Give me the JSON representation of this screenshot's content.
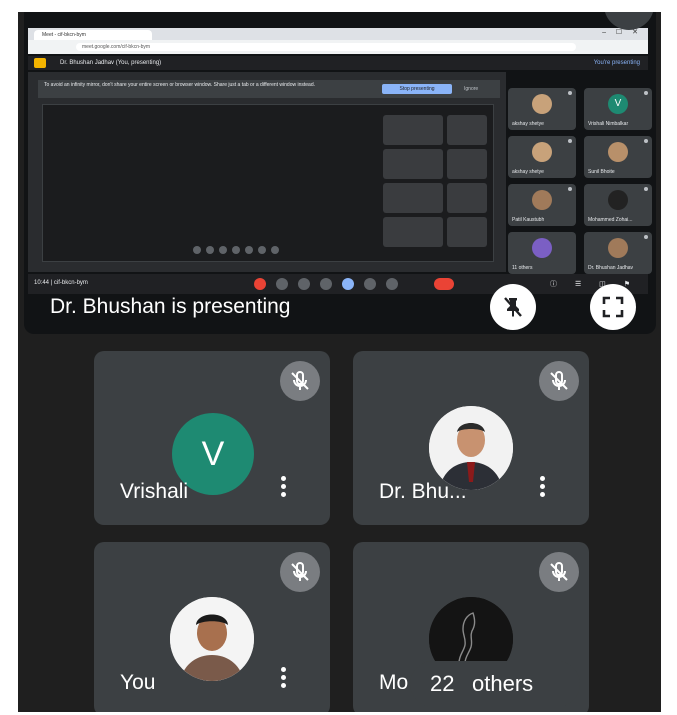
{
  "shared_screen": {
    "browser_tab": "Meet - cif-bkcn-bym",
    "window_controls": "– ☐ ✕",
    "address": "meet.google.com/cif-bkcn-bym",
    "meet_title": "Dr. Bhushan Jadhav (You, presenting)",
    "presenting_badge": "You're presenting",
    "notice_text": "To avoid an infinity mirror, don't share your entire screen or browser window. Share just a tab or a different window instead.",
    "notice_button": "Stop presenting",
    "notice_dismiss": "Ignore",
    "clock": "10:44  |  cif-bkcn-bym",
    "mini_tiles": [
      {
        "name": "akshay shetye",
        "avatar_color": "#c8a27a"
      },
      {
        "name": "Vrishali Nimbalkar",
        "avatar_color": "#1e8a72",
        "initial": "V"
      },
      {
        "name": "akshay shetye",
        "avatar_color": "#c8a27a"
      },
      {
        "name": "Sunil Bhoite",
        "avatar_color": "#b8906a"
      },
      {
        "name": "Patil Kaustubh",
        "avatar_color": "#a07a5a"
      },
      {
        "name": "Mohammed Zohai...",
        "avatar_color": "#222222"
      },
      {
        "name": "11 others",
        "avatar_color": "#7b5fc4"
      },
      {
        "name": "Dr. Bhushan Jadhav",
        "avatar_color": "#a07a5a"
      }
    ]
  },
  "presenter": {
    "label": "Dr. Bhushan is presenting"
  },
  "participants": [
    {
      "name": "Vrishali",
      "initial": "V",
      "avatar_type": "letter",
      "muted": true
    },
    {
      "name": "Dr. Bhu...",
      "avatar_type": "photo",
      "muted": true
    },
    {
      "name": "You",
      "avatar_type": "photo",
      "muted": true
    },
    {
      "name": "Mo",
      "avatar_type": "photo",
      "muted": true
    }
  ],
  "others": {
    "count": "22",
    "label": "others"
  },
  "colors": {
    "background": "#1f1f1f",
    "tile": "#3c4043",
    "avatar_green": "#1e8a72",
    "end_call": "#ea4335"
  },
  "icons": [
    "mic-off-icon",
    "pin-off-icon",
    "fullscreen-icon",
    "more-vert-icon"
  ]
}
